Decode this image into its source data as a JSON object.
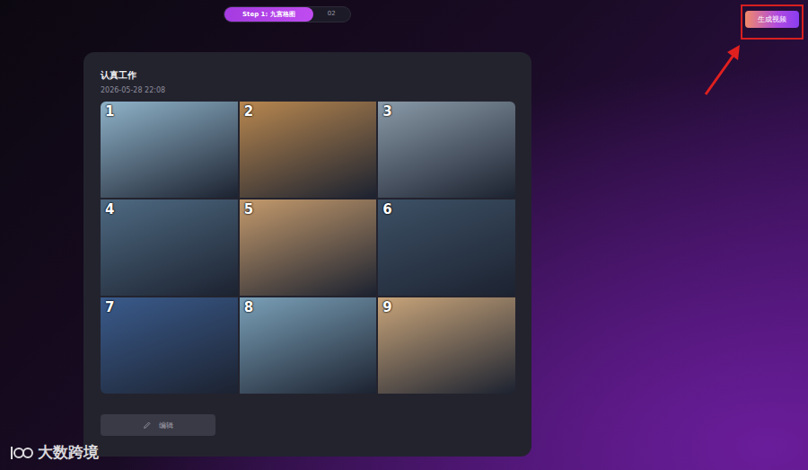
{
  "stepper": [
    {
      "label": "Step 1: 九宫格图",
      "selected": true
    },
    {
      "label": "02",
      "selected": false
    }
  ],
  "generate_button": {
    "label": "生成视频",
    "highlighted": true
  },
  "card": {
    "title": "认真工作",
    "timestamp": "2026-05-28 22:08",
    "panels": [
      {
        "number": "1",
        "color": "#8fb3c9"
      },
      {
        "number": "2",
        "color": "#b8874f"
      },
      {
        "number": "3",
        "color": "#8a9aa8"
      },
      {
        "number": "4",
        "color": "#4e6a82"
      },
      {
        "number": "5",
        "color": "#c49a6c"
      },
      {
        "number": "6",
        "color": "#3d5166"
      },
      {
        "number": "7",
        "color": "#3a5b8c"
      },
      {
        "number": "8",
        "color": "#7aa0b8"
      },
      {
        "number": "9",
        "color": "#c9a57a"
      }
    ],
    "edit_button": {
      "label": "编辑"
    }
  },
  "watermark": {
    "text": "大数跨境"
  }
}
